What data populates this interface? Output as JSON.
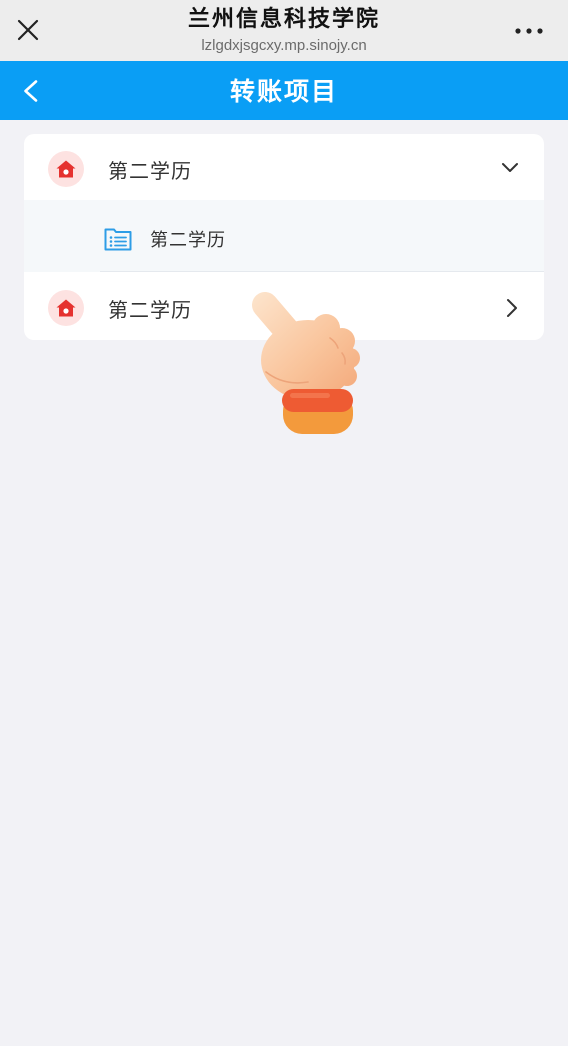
{
  "browser_bar": {
    "title": "兰州信息科技学院",
    "url": "lzlgdxjsgcxy.mp.sinojy.cn",
    "close_icon": "close-icon",
    "more_icon": "more-icon"
  },
  "header": {
    "title": "转账项目",
    "back_icon": "back-arrow-icon"
  },
  "project_list": {
    "items": [
      {
        "label": "第二学历",
        "icon": "house-icon",
        "expanded": true,
        "toggle_icon": "chevron-down-icon",
        "children": [
          {
            "label": "第二学历",
            "icon": "list-folder-icon"
          }
        ]
      },
      {
        "label": "第二学历",
        "icon": "house-icon",
        "expanded": false,
        "toggle_icon": "chevron-right-icon",
        "children": []
      }
    ]
  },
  "overlay": {
    "icon": "pointer-hand-icon"
  },
  "theme": {
    "header_blue": "#0a9ef5",
    "page_bg": "#f2f2f6",
    "icon_red": "#e5322f",
    "icon_pink": "#fde2e1",
    "list_blue": "#2d9de6",
    "subrow_bg": "#f5f8fa"
  }
}
